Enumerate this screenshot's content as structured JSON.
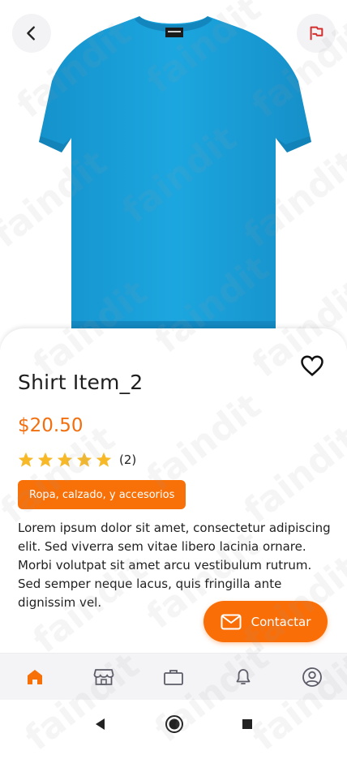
{
  "product": {
    "title": "Shirt Item_2",
    "price": "$20.50",
    "rating": 5,
    "review_count": "(2)",
    "category": "Ropa, calzado, y accesorios",
    "description": "Lorem ipsum dolor sit amet, consectetur adipiscing elit. Sed viverra sem vitae libero lacinia ornare. Morbi volutpat sit amet arcu vestibulum rutrum. Sed semper neque lacus, quis fringilla ante dignissim vel.",
    "image": "blue-tshirt"
  },
  "actions": {
    "contact_label": "Contactar",
    "back_icon": "chevron-left-icon",
    "report_icon": "flag-icon",
    "favorite_icon": "heart-outline-icon"
  },
  "bottom_nav": {
    "items": [
      {
        "name": "home",
        "icon": "home-icon",
        "active": true
      },
      {
        "name": "store",
        "icon": "store-icon",
        "active": false
      },
      {
        "name": "briefcase",
        "icon": "briefcase-icon",
        "active": false
      },
      {
        "name": "notifications",
        "icon": "bell-icon",
        "active": false
      },
      {
        "name": "profile",
        "icon": "user-circle-icon",
        "active": false
      }
    ]
  },
  "watermark": {
    "text": "faindit"
  },
  "colors": {
    "accent": "#f87008",
    "price": "#f26f0f",
    "star": "#f7b928",
    "flag": "#d32f2f",
    "shirt": "#1aa2dc"
  }
}
